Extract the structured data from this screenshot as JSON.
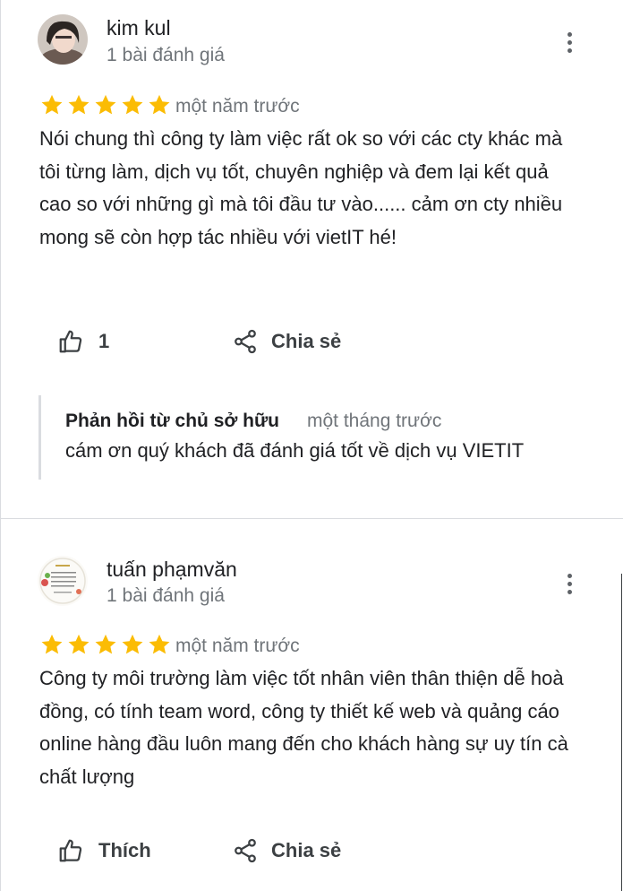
{
  "reviews": [
    {
      "author": "kim kul",
      "review_count": "1 bài đánh giá",
      "rating": 5,
      "time": "một năm trước",
      "text": "Nói chung thì công ty làm việc rất ok so với các cty khác mà tôi từng làm, dịch vụ tốt, chuyên nghiệp và đem lại kết quả cao so với những gì mà tôi đầu tư vào...... cảm ơn cty nhiều mong sẽ còn hợp tác nhiều với vietIT hé!",
      "like_label": "1",
      "share_label": "Chia sẻ",
      "owner_reply": {
        "title": "Phản hồi từ chủ sở hữu",
        "time": "một tháng trước",
        "text": "cám ơn quý khách đã đánh giá tốt về dịch vụ VIETIT"
      }
    },
    {
      "author": "tuấn phạmvăn",
      "review_count": "1 bài đánh giá",
      "rating": 5,
      "time": "một năm trước",
      "text": "Công ty môi trường làm việc tốt nhân viên thân thiện dễ hoà đồng, có tính team word, công ty thiết kế web và quảng cáo online hàng đầu luôn mang đến cho khách hàng sự uy tín cà chất lượng",
      "like_label": "Thích",
      "share_label": "Chia sẻ"
    }
  ],
  "colors": {
    "star": "#fbbc04",
    "muted_text": "#70757a",
    "divider": "#dadce0"
  },
  "icons": {
    "like": "thumbs-up-icon",
    "share": "share-icon",
    "menu": "more-vert-icon"
  }
}
